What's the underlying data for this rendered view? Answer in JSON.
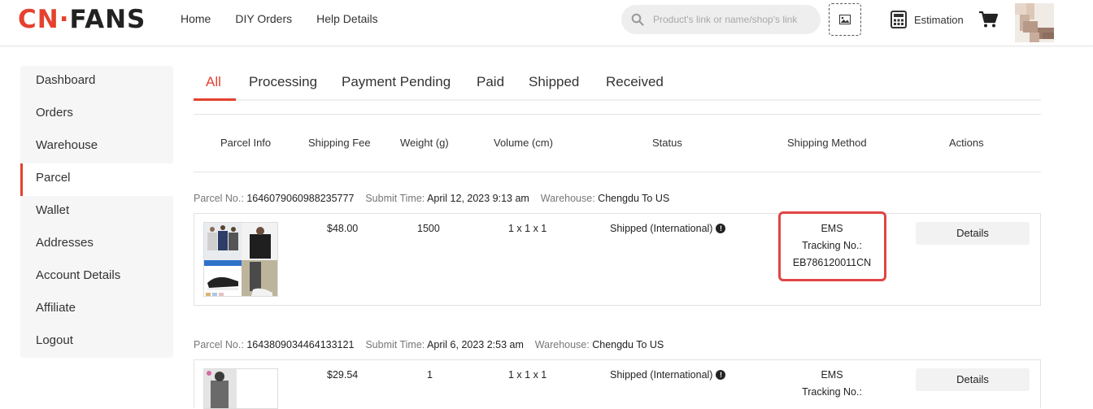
{
  "brand": {
    "logo_left": "CN",
    "logo_dot": "·",
    "logo_right": "FANS",
    "accent": "#e5412e"
  },
  "nav": {
    "items": [
      "Home",
      "DIY Orders",
      "Help Details"
    ]
  },
  "search": {
    "placeholder": "Product's link or name/shop's link"
  },
  "header": {
    "estimation_label": "Estimation"
  },
  "sidebar": {
    "items": [
      {
        "label": "Dashboard"
      },
      {
        "label": "Orders"
      },
      {
        "label": "Warehouse"
      },
      {
        "label": "Parcel",
        "active": true
      },
      {
        "label": "Wallet"
      },
      {
        "label": "Addresses"
      },
      {
        "label": "Account Details"
      },
      {
        "label": "Affiliate"
      },
      {
        "label": "Logout"
      }
    ]
  },
  "tabs": [
    "All",
    "Processing",
    "Payment Pending",
    "Paid",
    "Shipped",
    "Received"
  ],
  "table": {
    "columns": [
      "Parcel Info",
      "Shipping Fee",
      "Weight (g)",
      "Volume (cm)",
      "Status",
      "Shipping Method",
      "Actions"
    ]
  },
  "parcels": [
    {
      "parcel_no_label": "Parcel No.:",
      "parcel_no": "1646079060988235777",
      "submit_label": "Submit Time:",
      "submit_time": "April 12, 2023 9:13 am",
      "warehouse_label": "Warehouse:",
      "warehouse": "Chengdu To US",
      "fee": "$48.00",
      "weight": "1500",
      "volume": "1 x 1 x 1",
      "status": "Shipped (International)",
      "method": "EMS",
      "tracking_label": "Tracking No.:",
      "tracking": "EB786120011CN",
      "action": "Details"
    },
    {
      "parcel_no_label": "Parcel No.:",
      "parcel_no": "1643809034464133121",
      "submit_label": "Submit Time:",
      "submit_time": "April 6, 2023 2:53 am",
      "warehouse_label": "Warehouse:",
      "warehouse": "Chengdu To US",
      "fee": "$29.54",
      "weight": "1",
      "volume": "1 x 1 x 1",
      "status": "Shipped (International)",
      "method": "EMS",
      "tracking_label": "Tracking No.:",
      "tracking": "",
      "action": "Details"
    }
  ]
}
